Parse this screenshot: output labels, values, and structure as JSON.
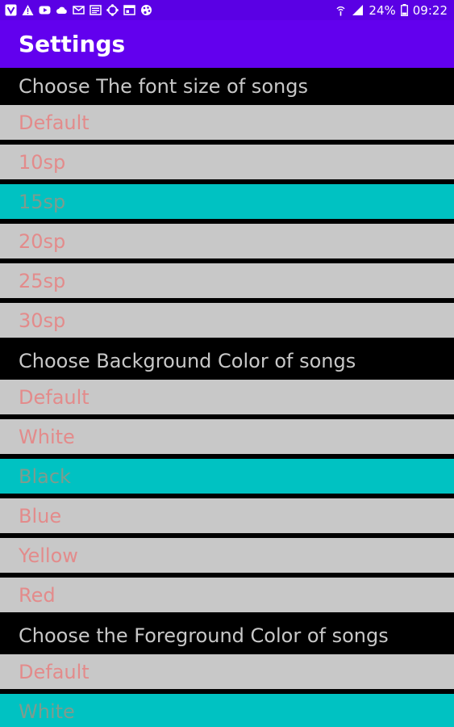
{
  "status_bar": {
    "battery": "24%",
    "time": "09:22",
    "left_icons": [
      "v-icon",
      "alert-triangle-icon",
      "youtube-icon",
      "cloud-icon",
      "mail-icon",
      "news-icon",
      "puzzle-icon",
      "calendar-icon",
      "palette-icon"
    ],
    "right_icons": [
      "hotspot-icon",
      "signal-icon",
      "battery-icon"
    ]
  },
  "app_bar": {
    "title": "Settings"
  },
  "sections": [
    {
      "header": "Choose The font size of songs",
      "options": [
        "Default",
        "10sp",
        "15sp",
        "20sp",
        "25sp",
        "30sp"
      ],
      "selected": "15sp"
    },
    {
      "header": "Choose Background Color of songs",
      "options": [
        "Default",
        "White",
        "Black",
        "Blue",
        "Yellow",
        "Red"
      ],
      "selected": "Black"
    },
    {
      "header": "Choose the Foreground Color of songs",
      "options": [
        "Default",
        "White"
      ],
      "selected": "White"
    }
  ],
  "colors": {
    "status_bar": "#5a00e4",
    "app_bar": "#6200ee",
    "header_bg": "#000000",
    "header_text": "#c8c8c8",
    "option_bg": "#c8c8c8",
    "option_text": "#e38b8b",
    "selected_bg": "#00c2c2",
    "selected_text": "#7e9c8e"
  }
}
